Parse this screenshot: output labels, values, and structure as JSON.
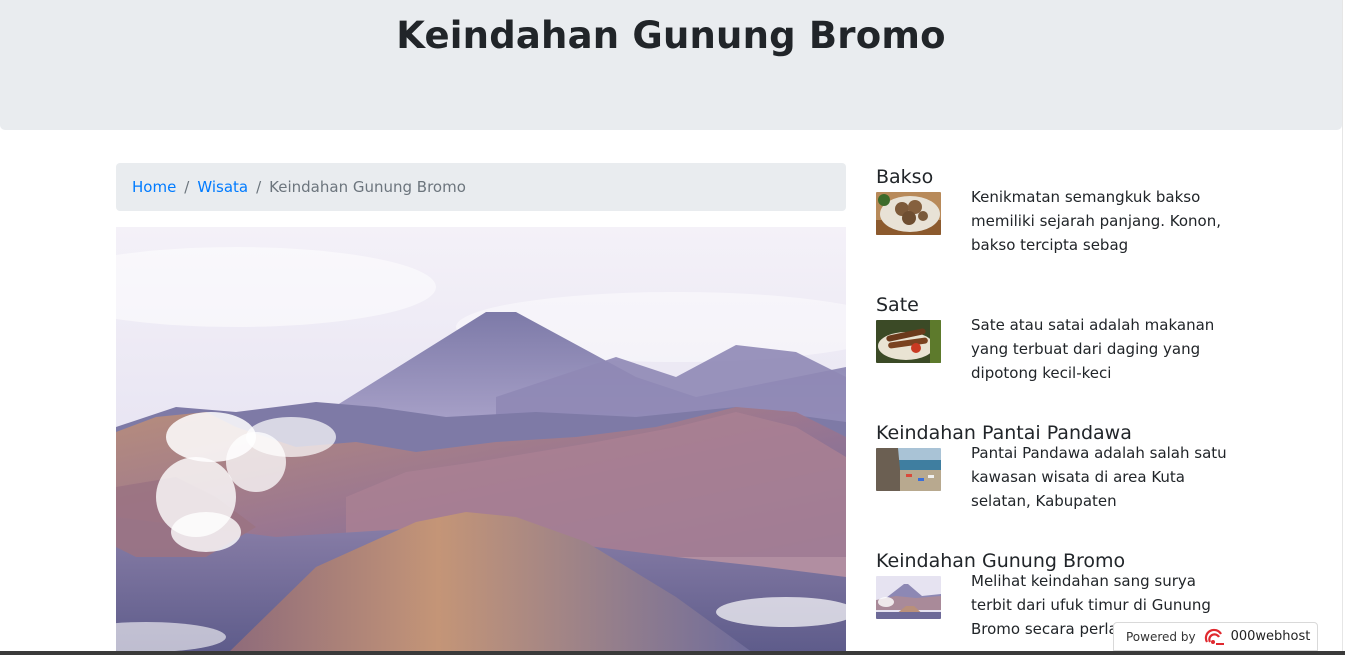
{
  "header": {
    "title": "Keindahan Gunung Bromo"
  },
  "breadcrumb": {
    "items": [
      {
        "label": "Home",
        "link": true
      },
      {
        "label": "Wisata",
        "link": true
      },
      {
        "label": "Keindahan Gunung Bromo",
        "link": false
      }
    ],
    "separator": "/"
  },
  "hero": {
    "image_subject": "Gunung Bromo volcanic landscape"
  },
  "sidebar": {
    "items": [
      {
        "title": "Bakso",
        "excerpt": "Kenikmatan semangkuk bakso memiliki sejarah panjang. Konon, bakso tercipta sebag"
      },
      {
        "title": "Sate",
        "excerpt": "Sate atau satai adalah makanan yang terbuat dari daging yang dipotong kecil-keci"
      },
      {
        "title": "Keindahan Pantai Pandawa",
        "excerpt": "Pantai Pandawa adalah salah satu kawasan wisata di area Kuta selatan, Kabupaten"
      },
      {
        "title": "Keindahan Gunung Bromo",
        "excerpt": "Melihat keindahan sang surya terbit dari ufuk timur di Gunung Bromo secara perla"
      }
    ]
  },
  "footer_badge": {
    "prefix": "Powered by",
    "brand": "000webhost"
  },
  "colors": {
    "link": "#007bff",
    "muted": "#6c757d",
    "jumbotron": "#e9ecef",
    "brand_red": "#e0292f"
  }
}
